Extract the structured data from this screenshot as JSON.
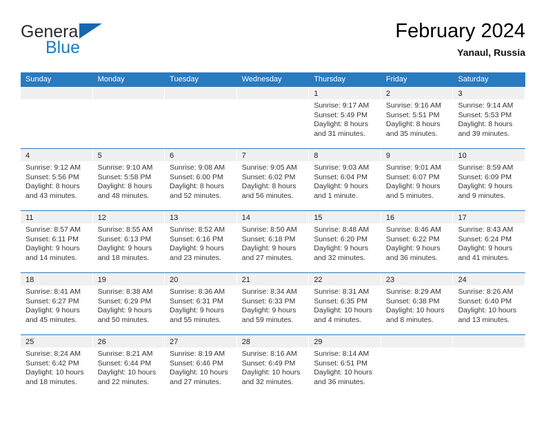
{
  "brand": {
    "name_top": "General",
    "name_bottom": "Blue",
    "accent_color": "#1b7ac4"
  },
  "header": {
    "title": "February 2024",
    "location": "Yanaul, Russia"
  },
  "theme": {
    "header_blue": "#2a7ac0",
    "date_band": "#f0f0f0",
    "text": "#333333"
  },
  "weekdays": [
    "Sunday",
    "Monday",
    "Tuesday",
    "Wednesday",
    "Thursday",
    "Friday",
    "Saturday"
  ],
  "weeks": [
    [
      {
        "day": "",
        "lines": []
      },
      {
        "day": "",
        "lines": []
      },
      {
        "day": "",
        "lines": []
      },
      {
        "day": "",
        "lines": []
      },
      {
        "day": "1",
        "lines": [
          "Sunrise: 9:17 AM",
          "Sunset: 5:49 PM",
          "Daylight: 8 hours",
          "and 31 minutes."
        ]
      },
      {
        "day": "2",
        "lines": [
          "Sunrise: 9:16 AM",
          "Sunset: 5:51 PM",
          "Daylight: 8 hours",
          "and 35 minutes."
        ]
      },
      {
        "day": "3",
        "lines": [
          "Sunrise: 9:14 AM",
          "Sunset: 5:53 PM",
          "Daylight: 8 hours",
          "and 39 minutes."
        ]
      }
    ],
    [
      {
        "day": "4",
        "lines": [
          "Sunrise: 9:12 AM",
          "Sunset: 5:56 PM",
          "Daylight: 8 hours",
          "and 43 minutes."
        ]
      },
      {
        "day": "5",
        "lines": [
          "Sunrise: 9:10 AM",
          "Sunset: 5:58 PM",
          "Daylight: 8 hours",
          "and 48 minutes."
        ]
      },
      {
        "day": "6",
        "lines": [
          "Sunrise: 9:08 AM",
          "Sunset: 6:00 PM",
          "Daylight: 8 hours",
          "and 52 minutes."
        ]
      },
      {
        "day": "7",
        "lines": [
          "Sunrise: 9:05 AM",
          "Sunset: 6:02 PM",
          "Daylight: 8 hours",
          "and 56 minutes."
        ]
      },
      {
        "day": "8",
        "lines": [
          "Sunrise: 9:03 AM",
          "Sunset: 6:04 PM",
          "Daylight: 9 hours",
          "and 1 minute."
        ]
      },
      {
        "day": "9",
        "lines": [
          "Sunrise: 9:01 AM",
          "Sunset: 6:07 PM",
          "Daylight: 9 hours",
          "and 5 minutes."
        ]
      },
      {
        "day": "10",
        "lines": [
          "Sunrise: 8:59 AM",
          "Sunset: 6:09 PM",
          "Daylight: 9 hours",
          "and 9 minutes."
        ]
      }
    ],
    [
      {
        "day": "11",
        "lines": [
          "Sunrise: 8:57 AM",
          "Sunset: 6:11 PM",
          "Daylight: 9 hours",
          "and 14 minutes."
        ]
      },
      {
        "day": "12",
        "lines": [
          "Sunrise: 8:55 AM",
          "Sunset: 6:13 PM",
          "Daylight: 9 hours",
          "and 18 minutes."
        ]
      },
      {
        "day": "13",
        "lines": [
          "Sunrise: 8:52 AM",
          "Sunset: 6:16 PM",
          "Daylight: 9 hours",
          "and 23 minutes."
        ]
      },
      {
        "day": "14",
        "lines": [
          "Sunrise: 8:50 AM",
          "Sunset: 6:18 PM",
          "Daylight: 9 hours",
          "and 27 minutes."
        ]
      },
      {
        "day": "15",
        "lines": [
          "Sunrise: 8:48 AM",
          "Sunset: 6:20 PM",
          "Daylight: 9 hours",
          "and 32 minutes."
        ]
      },
      {
        "day": "16",
        "lines": [
          "Sunrise: 8:46 AM",
          "Sunset: 6:22 PM",
          "Daylight: 9 hours",
          "and 36 minutes."
        ]
      },
      {
        "day": "17",
        "lines": [
          "Sunrise: 8:43 AM",
          "Sunset: 6:24 PM",
          "Daylight: 9 hours",
          "and 41 minutes."
        ]
      }
    ],
    [
      {
        "day": "18",
        "lines": [
          "Sunrise: 8:41 AM",
          "Sunset: 6:27 PM",
          "Daylight: 9 hours",
          "and 45 minutes."
        ]
      },
      {
        "day": "19",
        "lines": [
          "Sunrise: 8:38 AM",
          "Sunset: 6:29 PM",
          "Daylight: 9 hours",
          "and 50 minutes."
        ]
      },
      {
        "day": "20",
        "lines": [
          "Sunrise: 8:36 AM",
          "Sunset: 6:31 PM",
          "Daylight: 9 hours",
          "and 55 minutes."
        ]
      },
      {
        "day": "21",
        "lines": [
          "Sunrise: 8:34 AM",
          "Sunset: 6:33 PM",
          "Daylight: 9 hours",
          "and 59 minutes."
        ]
      },
      {
        "day": "22",
        "lines": [
          "Sunrise: 8:31 AM",
          "Sunset: 6:35 PM",
          "Daylight: 10 hours",
          "and 4 minutes."
        ]
      },
      {
        "day": "23",
        "lines": [
          "Sunrise: 8:29 AM",
          "Sunset: 6:38 PM",
          "Daylight: 10 hours",
          "and 8 minutes."
        ]
      },
      {
        "day": "24",
        "lines": [
          "Sunrise: 8:26 AM",
          "Sunset: 6:40 PM",
          "Daylight: 10 hours",
          "and 13 minutes."
        ]
      }
    ],
    [
      {
        "day": "25",
        "lines": [
          "Sunrise: 8:24 AM",
          "Sunset: 6:42 PM",
          "Daylight: 10 hours",
          "and 18 minutes."
        ]
      },
      {
        "day": "26",
        "lines": [
          "Sunrise: 8:21 AM",
          "Sunset: 6:44 PM",
          "Daylight: 10 hours",
          "and 22 minutes."
        ]
      },
      {
        "day": "27",
        "lines": [
          "Sunrise: 8:19 AM",
          "Sunset: 6:46 PM",
          "Daylight: 10 hours",
          "and 27 minutes."
        ]
      },
      {
        "day": "28",
        "lines": [
          "Sunrise: 8:16 AM",
          "Sunset: 6:49 PM",
          "Daylight: 10 hours",
          "and 32 minutes."
        ]
      },
      {
        "day": "29",
        "lines": [
          "Sunrise: 8:14 AM",
          "Sunset: 6:51 PM",
          "Daylight: 10 hours",
          "and 36 minutes."
        ]
      },
      {
        "day": "",
        "lines": []
      },
      {
        "day": "",
        "lines": []
      }
    ]
  ]
}
